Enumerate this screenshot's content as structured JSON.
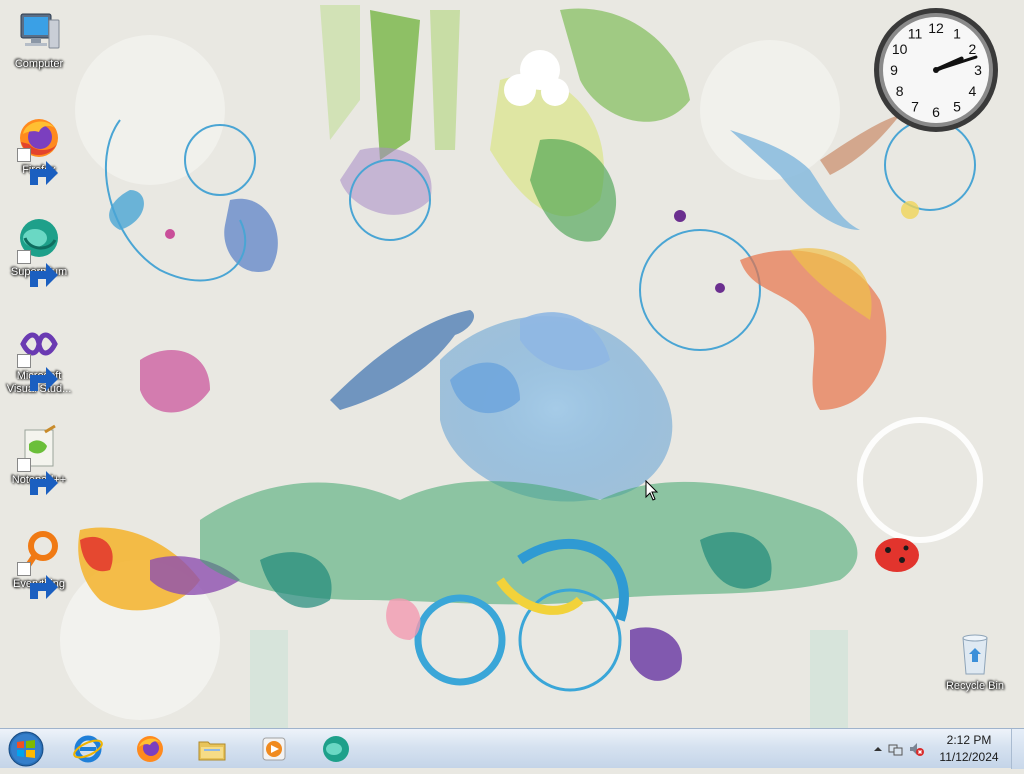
{
  "desktop": {
    "icons": [
      {
        "label": "Computer",
        "icon": "computer-icon"
      },
      {
        "label": "Firefox",
        "icon": "firefox-icon"
      },
      {
        "label": "Supermium",
        "icon": "supermium-icon"
      },
      {
        "label": "Microsoft Visual Stud...",
        "icon": "visual-studio-icon"
      },
      {
        "label": "Notepad++",
        "icon": "notepadpp-icon"
      },
      {
        "label": "Everything",
        "icon": "everything-icon"
      },
      {
        "label": "Recycle Bin",
        "icon": "recycle-bin-icon"
      }
    ],
    "wallpaper": "floral-watercolor-wallpaper"
  },
  "clock_gadget": {
    "numbers": [
      "12",
      "1",
      "2",
      "3",
      "4",
      "5",
      "6",
      "7",
      "8",
      "9",
      "10",
      "11"
    ],
    "hour": 2,
    "minute": 12
  },
  "taskbar": {
    "start_icon": "windows-logo-icon",
    "pinned": [
      {
        "name": "Internet Explorer",
        "icon": "internet-explorer-icon"
      },
      {
        "name": "Firefox",
        "icon": "firefox-icon"
      },
      {
        "name": "Windows Explorer",
        "icon": "folder-icon"
      },
      {
        "name": "Windows Media Player",
        "icon": "media-player-icon"
      },
      {
        "name": "Supermium",
        "icon": "supermium-icon"
      }
    ],
    "tray": {
      "time": "2:12 PM",
      "date": "11/12/2024",
      "icons": [
        "show-hidden-icons-icon",
        "network-icon",
        "volume-muted-icon"
      ]
    }
  },
  "colors": {
    "taskbar_top": "#eef3fa",
    "taskbar_bottom": "#c4d4e8",
    "desktop_bg": "#e9e8e2"
  }
}
